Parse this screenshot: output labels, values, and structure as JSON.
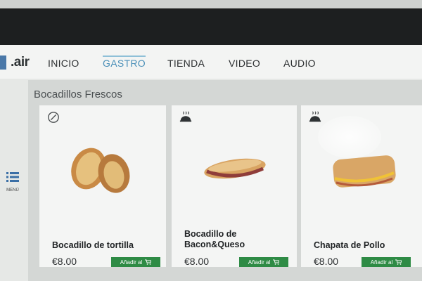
{
  "app": {
    "logo_text": ".air"
  },
  "nav": {
    "items": [
      {
        "label": "INICIO"
      },
      {
        "label": "GASTRO"
      },
      {
        "label": "TIENDA"
      },
      {
        "label": "VIDEO"
      },
      {
        "label": "AUDIO"
      }
    ],
    "active": "GASTRO"
  },
  "sidebar": {
    "menu_label": "MENÚ",
    "menu_icon": "list-menu-icon"
  },
  "section": {
    "title": "Bocadillos Frescos"
  },
  "products": [
    {
      "name": "Bocadillo de tortilla",
      "price": "€8.00",
      "button_label": "Añadir al",
      "tag_icon": "leaf-icon"
    },
    {
      "name_line1": "Bocadillo de",
      "name_line2": "Bacon&Queso",
      "price": "€8.00",
      "button_label": "Añadir al",
      "tag_icon": "hot-dish-icon"
    },
    {
      "name": "Chapata de Pollo",
      "price": "€8.00",
      "button_label": "Añadir al",
      "tag_icon": "hot-dish-icon"
    }
  ],
  "colors": {
    "accent": "#4a8fb8",
    "add_button": "#2e8b45"
  }
}
